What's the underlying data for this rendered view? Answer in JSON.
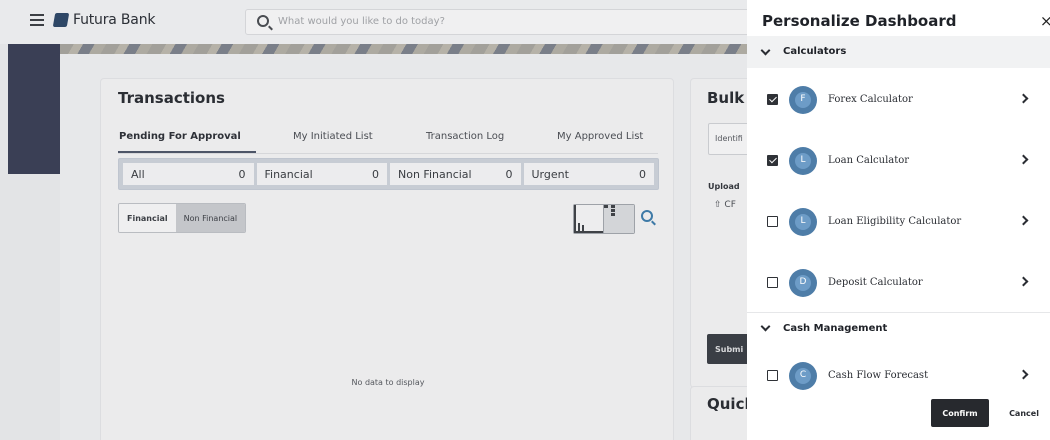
{
  "header": {
    "brand": "Futura Bank",
    "search_placeholder": "What would you like to do today?"
  },
  "transactions": {
    "title": "Transactions",
    "tabs": [
      "Pending For Approval",
      "My Initiated List",
      "Transaction Log",
      "My Approved List"
    ],
    "counts": [
      {
        "label": "All",
        "value": "0"
      },
      {
        "label": "Financial",
        "value": "0"
      },
      {
        "label": "Non Financial",
        "value": "0"
      },
      {
        "label": "Urgent",
        "value": "0"
      }
    ],
    "segments": [
      "Financial",
      "Non Financial"
    ],
    "empty_text": "No data to display"
  },
  "bulk": {
    "title": "Bulk l",
    "identifier": "Identifi",
    "upload": "Upload",
    "cf": "CF",
    "submit": "Submi"
  },
  "quick": {
    "title": "Quick"
  },
  "panel": {
    "title": "Personalize Dashboard",
    "sections": [
      {
        "name": "Calculators",
        "items": [
          {
            "initial": "F",
            "label": "Forex Calculator",
            "checked": true
          },
          {
            "initial": "L",
            "label": "Loan Calculator",
            "checked": true
          },
          {
            "initial": "L",
            "label": "Loan Eligibility Calculator",
            "checked": false
          },
          {
            "initial": "D",
            "label": "Deposit Calculator",
            "checked": false
          }
        ]
      },
      {
        "name": "Cash Management",
        "items": [
          {
            "initial": "C",
            "label": "Cash Flow Forecast",
            "checked": false
          }
        ]
      }
    ],
    "confirm": "Confirm",
    "cancel": "Cancel",
    "close": "×"
  },
  "colors": {
    "avatar": "#4e7da8",
    "confirm": "#27292e"
  }
}
